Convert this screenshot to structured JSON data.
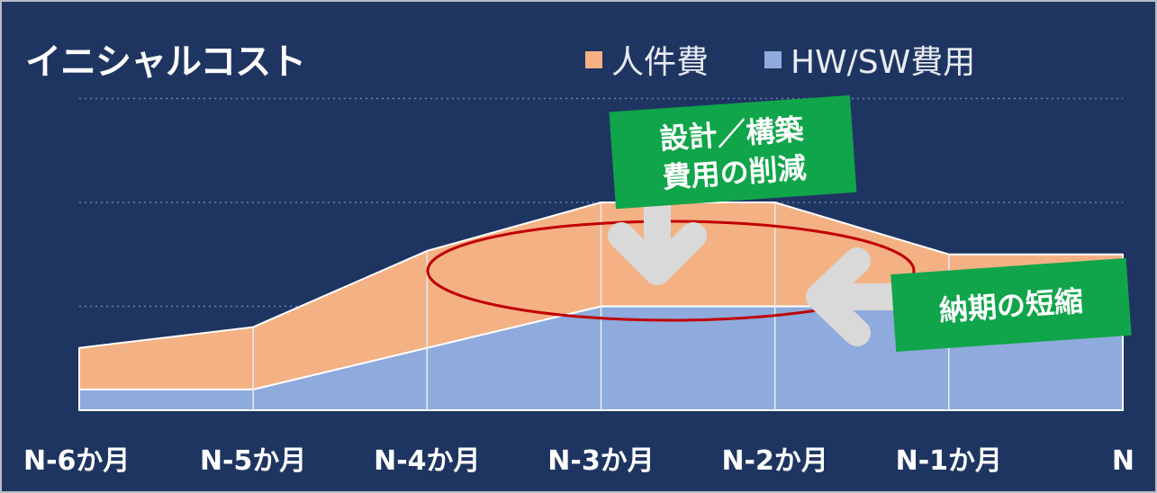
{
  "chart_data": {
    "type": "area",
    "stacked": true,
    "title": "イニシャルコスト",
    "categories": [
      "N-6か月",
      "N-5か月",
      "N-4か月",
      "N-3か月",
      "N-2か月",
      "N-1か月",
      "N"
    ],
    "series": [
      {
        "name": "HW/SW費用",
        "color": "#8faadc",
        "values": [
          0.6,
          0.6,
          1.8,
          3.0,
          3.0,
          3.0,
          3.0
        ]
      },
      {
        "name": "人件費",
        "color": "#f4b183",
        "values": [
          1.2,
          1.8,
          2.8,
          3.0,
          3.0,
          1.5,
          1.5
        ]
      }
    ],
    "ylim": [
      0,
      6
    ],
    "gridlines": [
      3,
      6,
      9
    ],
    "grid_style": "dotted",
    "legend_position": "top-right",
    "annotations": [
      {
        "text": "設計／構築\n費用の削減",
        "style": "green-box"
      },
      {
        "text": "納期の短縮",
        "style": "green-box"
      }
    ]
  },
  "colors": {
    "background": "#1f3561",
    "frame_border": "#b8bcc4",
    "callout_green": "#10a54a",
    "arrow": "#d9d9d9",
    "ellipse": "#c00000",
    "grid": "#6f82a8"
  }
}
